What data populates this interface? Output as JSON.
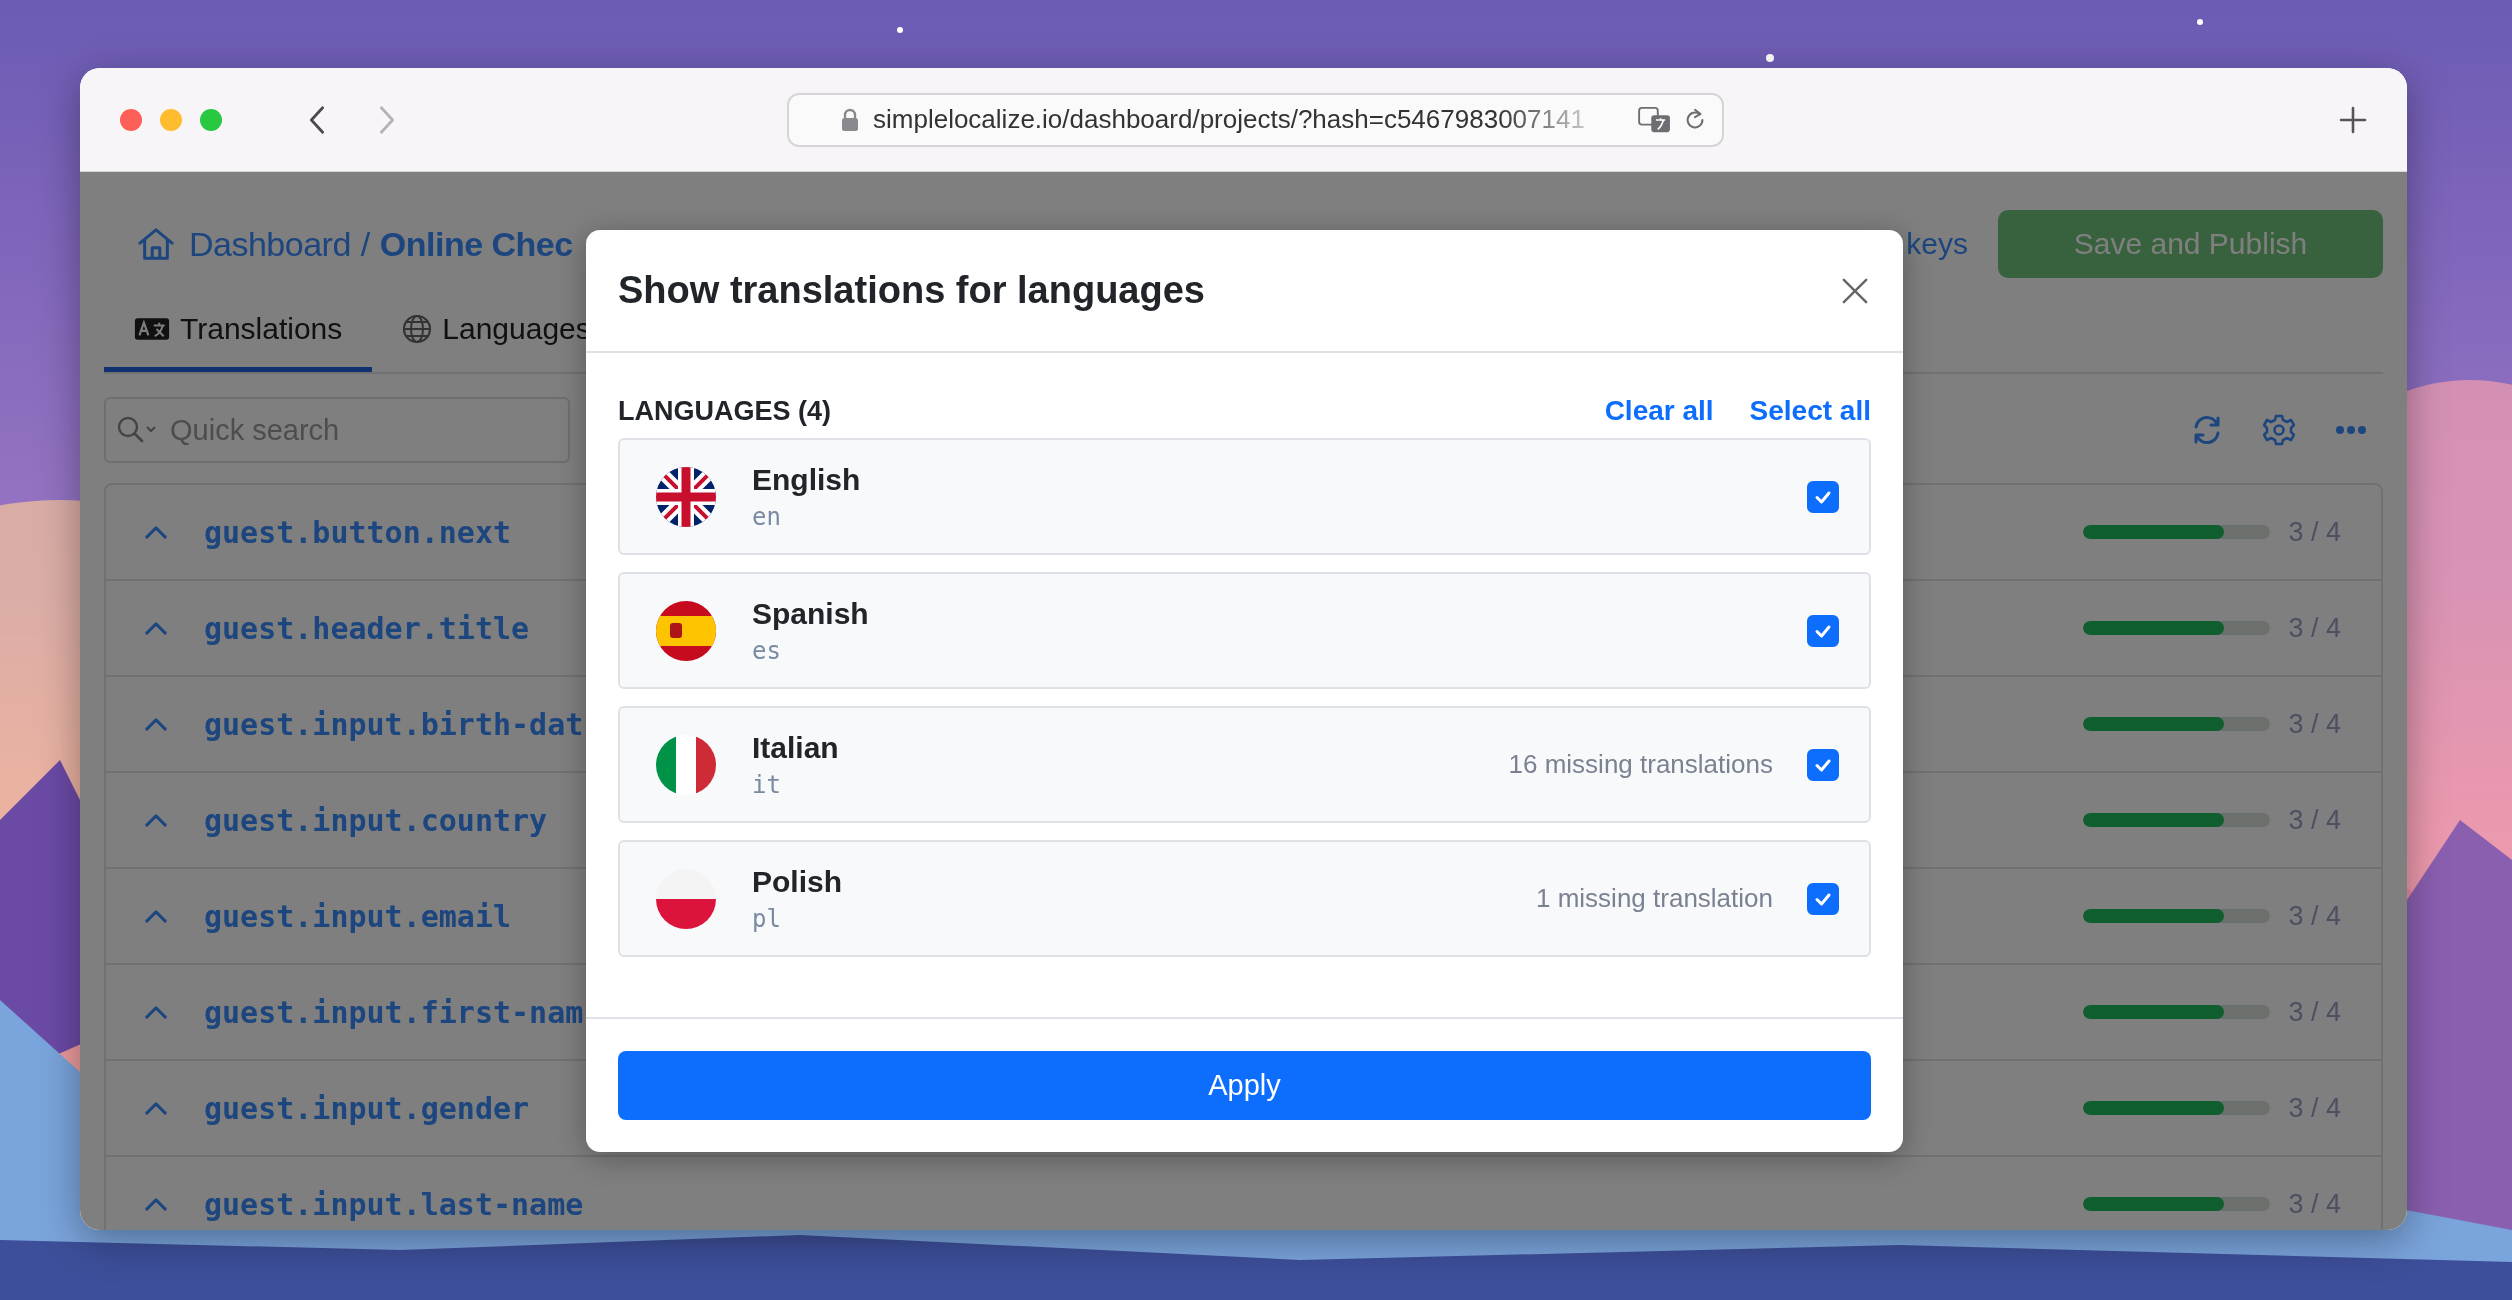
{
  "browser": {
    "url": "simplelocalize.io/dashboard/projects/?hash=c5467983007141",
    "nav_buttons": [
      {
        "kind": "back",
        "disabled": false
      },
      {
        "kind": "forward",
        "disabled": true
      }
    ]
  },
  "breadcrumb": {
    "root": "Dashboard",
    "separator": "/",
    "current": "Online Chec"
  },
  "header_link": "keys",
  "publish_button": {
    "label": "Save and Publish",
    "disabled": true
  },
  "tabs": [
    {
      "label": "Translations",
      "selected": true
    },
    {
      "label": "Languages",
      "selected": false
    }
  ],
  "search": {
    "placeholder": "Quick search"
  },
  "keys": [
    {
      "key": "guest.button.next",
      "level": 0.75,
      "progress": "3 / 4"
    },
    {
      "key": "guest.header.title",
      "level": 0.75,
      "progress": "3 / 4"
    },
    {
      "key": "guest.input.birth-dat",
      "level": 0.75,
      "progress": "3 / 4"
    },
    {
      "key": "guest.input.country",
      "level": 0.75,
      "progress": "3 / 4"
    },
    {
      "key": "guest.input.email",
      "level": 0.75,
      "progress": "3 / 4"
    },
    {
      "key": "guest.input.first-nam",
      "level": 0.75,
      "progress": "3 / 4"
    },
    {
      "key": "guest.input.gender",
      "level": 0.75,
      "progress": "3 / 4"
    },
    {
      "key": "guest.input.last-name",
      "level": 0.75,
      "progress": "3 / 4"
    }
  ],
  "dialog": {
    "title": "Show translations for languages",
    "section_label": "LANGUAGES (4)",
    "actions": [
      "Clear all",
      "Select all"
    ],
    "languages": [
      {
        "name": "English",
        "code": "en",
        "checked": true
      },
      {
        "name": "Spanish",
        "code": "es",
        "checked": true
      },
      {
        "name": "Italian",
        "code": "it",
        "missing": "16 missing translations",
        "checked": true
      },
      {
        "name": "Polish",
        "code": "pl",
        "missing": "1 missing translation",
        "checked": true
      }
    ],
    "apply_button": "Apply"
  }
}
